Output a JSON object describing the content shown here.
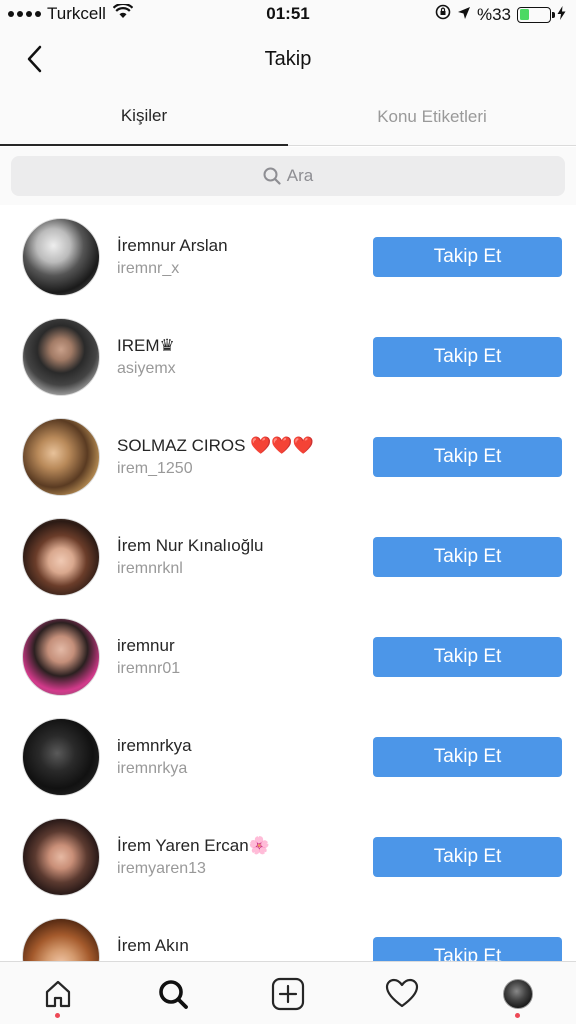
{
  "status_bar": {
    "carrier": "Turkcell",
    "time": "01:51",
    "battery_text": "%33",
    "battery_level": 0.33
  },
  "header": {
    "title": "Takip"
  },
  "tabs": [
    {
      "label": "Kişiler",
      "active": true
    },
    {
      "label": "Konu Etiketleri",
      "active": false
    }
  ],
  "search": {
    "placeholder": "Ara"
  },
  "users": [
    {
      "name": "İremnur Arslan",
      "username": "iremnr_x",
      "button": "Takip Et"
    },
    {
      "name": "IREM♛",
      "username": "asiyemx",
      "button": "Takip Et"
    },
    {
      "name": "SOLMAZ CIROS ❤️❤️❤️",
      "username": "irem_1250",
      "button": "Takip Et"
    },
    {
      "name": "İrem Nur Kınalıoğlu",
      "username": "iremnrknl",
      "button": "Takip Et"
    },
    {
      "name": "iremnur",
      "username": "iremnr01",
      "button": "Takip Et"
    },
    {
      "name": "iremnrkya",
      "username": "iremnrkya",
      "button": "Takip Et"
    },
    {
      "name": "İrem Yaren Ercan🌸",
      "username": "iremyaren13",
      "button": "Takip Et"
    },
    {
      "name": "İrem Akın",
      "username": "",
      "button": "Takip Et"
    }
  ],
  "nav": {
    "items": [
      "home-icon",
      "search-icon",
      "add-icon",
      "heart-icon",
      "profile-avatar"
    ],
    "accent_color": "#4c96e8",
    "notification_color": "#ed4956"
  }
}
